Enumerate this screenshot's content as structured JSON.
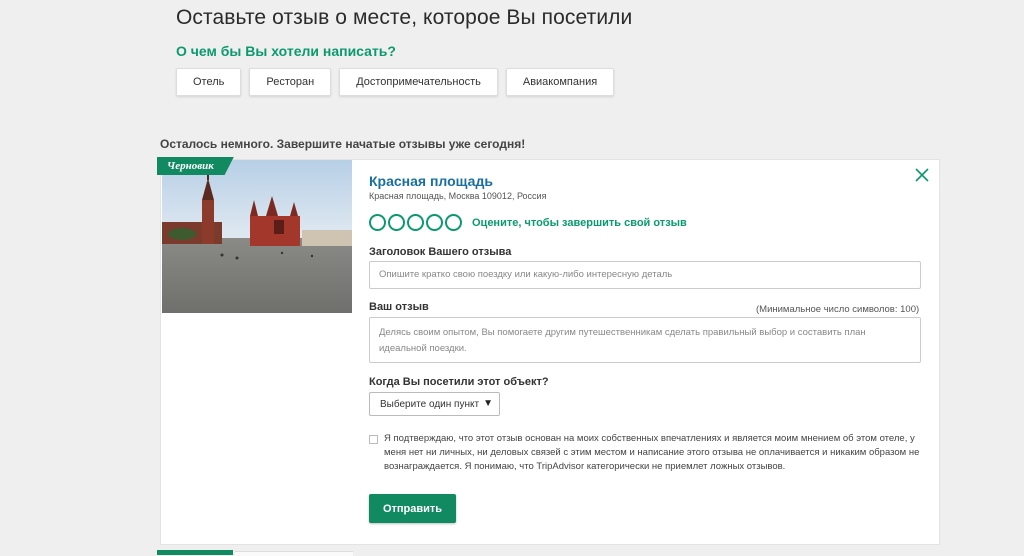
{
  "header": {
    "title": "Оставьте отзыв о месте, которое Вы посетили",
    "subtitle": "О чем бы Вы хотели написать?",
    "categories": [
      "Отель",
      "Ресторан",
      "Достопримечательность",
      "Авиакомпания"
    ]
  },
  "reminder": "Осталось немного. Завершите начатые отзывы уже сегодня!",
  "draft": {
    "tag": "Черновик",
    "place_name": "Красная площадь",
    "place_address": "Красная площадь, Москва 109012, Россия",
    "rating_prompt": "Оцените, чтобы завершить свой отзыв",
    "title_label": "Заголовок Вашего отзыва",
    "title_placeholder": "Опишите кратко свою поездку или какую-либо интересную деталь",
    "review_label": "Ваш отзыв",
    "min_chars": "(Минимальное число символов: 100)",
    "review_placeholder": "Делясь своим опытом, Вы помогаете другим путешественникам сделать правильный выбор и составить план идеальной поездки.",
    "visit_label": "Когда Вы посетили этот объект?",
    "visit_select": "Выберите один пункт",
    "consent_text": "Я подтверждаю, что этот отзыв основан на моих собственных впечатлениях и является моим мнением об этом отеле, у меня нет ни личных, ни деловых связей с этим местом и написание этого отзыва не оплачивается и никаким образом не вознаграждается. Я понимаю, что TripAdvisor категорически не приемлет ложных отзывов.",
    "submit_label": "Отправить"
  },
  "colors": {
    "accent": "#0a9a6d",
    "button": "#128a61",
    "link": "#1a6fa1",
    "background": "#efefef"
  },
  "icons": {
    "close": "close-icon",
    "select_arrow": "triangle-down-icon"
  }
}
